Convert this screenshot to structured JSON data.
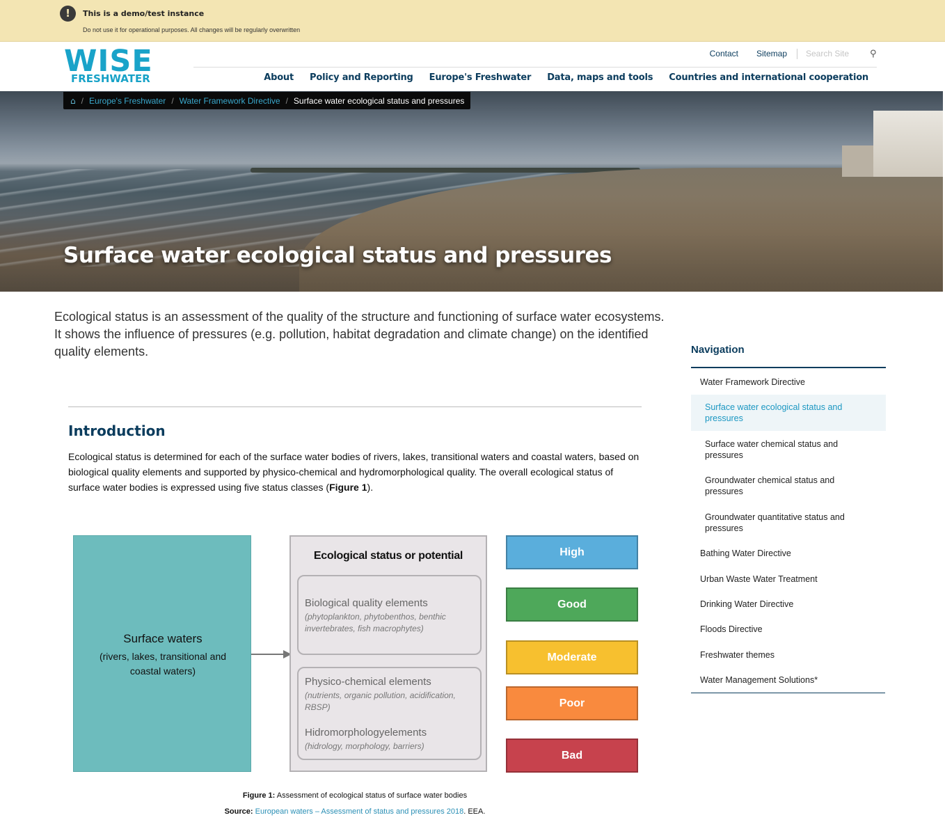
{
  "demo_banner": {
    "icon": "exclamation-icon",
    "title": "This is a demo/test instance",
    "subtitle": "Do not use it for operational purposes. All changes will be regularly overwritten"
  },
  "header": {
    "logo_top": "WISE",
    "logo_bottom": "FRESHWATER",
    "top_links": [
      "Contact",
      "Sitemap"
    ],
    "search_placeholder": "Search Site",
    "search_icon": "search-icon",
    "nav": [
      "About",
      "Policy and Reporting",
      "Europe's Freshwater",
      "Data, maps and tools",
      "Countries and international cooperation"
    ]
  },
  "hero": {
    "breadcrumb": [
      "Europe's Freshwater",
      "Water Framework Directive"
    ],
    "breadcrumb_current": "Surface water ecological status and pressures",
    "title": "Surface water ecological status and pressures"
  },
  "lead": "Ecological status is an assessment of the quality of the structure and functioning of surface water ecosystems. It shows the influence of pressures (e.g. pollution, habitat degradation and climate change) on the identified quality elements.",
  "intro": {
    "heading": "Introduction",
    "text_before": "Ecological status is determined for each of the surface water bodies of rivers, lakes, transitional waters and coastal waters, based on biological quality elements and supported by physico-chemical and hydromorphological quality. The overall ecological status of surface water bodies is expressed using five status classes (",
    "text_bold": "Figure 1",
    "text_after": ")."
  },
  "figure": {
    "surface_title": "Surface waters",
    "surface_sub": "(rivers, lakes, transitional and coastal waters)",
    "eco_title": "Ecological status or potential",
    "bio_title": "Biological quality elements",
    "bio_sub": "(phytoplankton, phytobenthos, benthic invertebrates, fish macrophytes)",
    "phys_title": "Physico-chemical elements",
    "phys_sub": "(nutrients, organic pollution, acidification, RBSP)",
    "hydro_title": "Hidromorphologyelements",
    "hydro_sub": "(hidrology, morphology, barriers)",
    "statuses": [
      {
        "label": "High",
        "color": "#5aaedc"
      },
      {
        "label": "Good",
        "color": "#4ea85a"
      },
      {
        "label": "Moderate",
        "color": "#f7c02f"
      },
      {
        "label": "Poor",
        "color": "#f98a3e"
      },
      {
        "label": "Bad",
        "color": "#c7424d"
      }
    ],
    "caption_bold": "Figure 1:",
    "caption": "Assessment of ecological status of surface water bodies",
    "source_bold": "Source:",
    "source_link": "European waters – Assessment of status and pressures 2018",
    "source_after": ". EEA."
  },
  "sidebar": {
    "title": "Navigation",
    "items": [
      "Water Framework Directive",
      "Surface water ecological status and pressures",
      "Surface water chemical status and pressures",
      "Groundwater chemical status and pressures",
      "Groundwater quantitative status and pressures",
      "Bathing Water Directive",
      "Urban Waste Water Treatment",
      "Drinking Water Directive",
      "Floods Directive",
      "Freshwater themes",
      "Water Management Solutions*"
    ]
  }
}
